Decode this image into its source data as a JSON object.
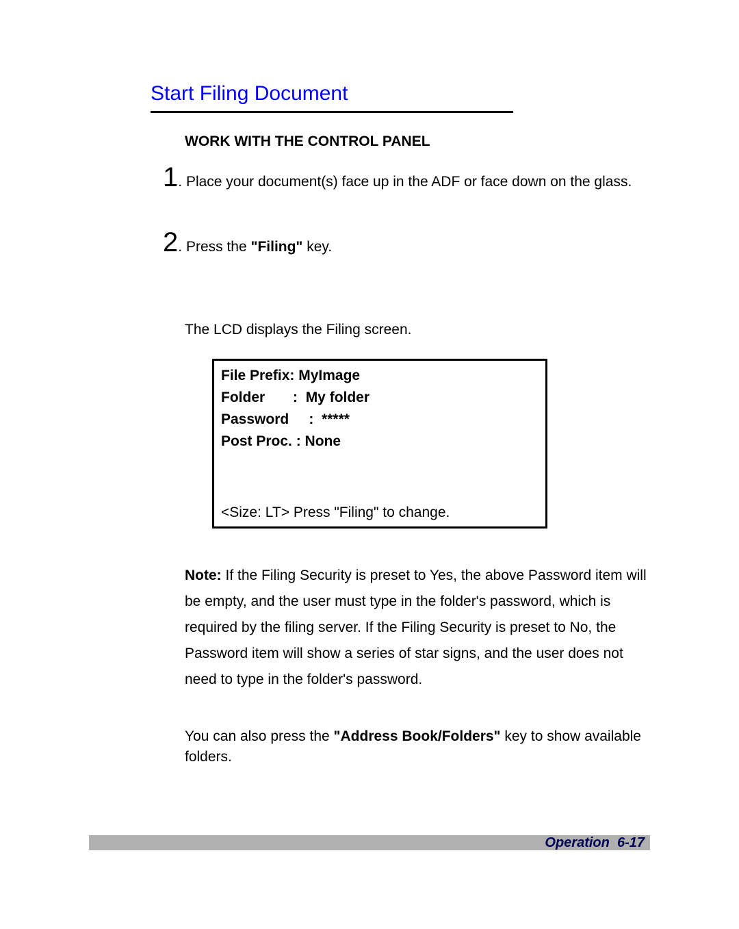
{
  "title": "Start Filing Document",
  "subheading": "WORK WITH THE CONTROL PANEL",
  "step1": {
    "num": "1",
    "text": "Place your document(s) face up in the ADF or face down on the glass."
  },
  "step2": {
    "num": "2",
    "textPrefix": "Press the ",
    "keyName": "\"Filing\"",
    "textSuffix": " key."
  },
  "lcdIntro": "The LCD displays the Filing screen.",
  "lcd": {
    "filePrefix": {
      "label": "File Prefix:",
      "value": "MyImage"
    },
    "folder": {
      "label": "Folder",
      "sep": ":",
      "value": "My  folder"
    },
    "password": {
      "label": "Password",
      "sep": ":",
      "value": "*****"
    },
    "postProc": {
      "label": "Post Proc. :",
      "value": "None"
    },
    "status": "<Size: LT> Press \"Filing\" to change."
  },
  "note": {
    "prefix": "Note:",
    "body": "If the Filing Security is preset to Yes, the above Password item will be empty, and the user must type in the folder's password, which is required by the filing server. If the Filing Security is preset to No, the Password item will show a series of star signs, and the user does not need to type in the folder's password."
  },
  "addrPara": {
    "prefix": "You can also press the ",
    "keyName": "\"Address Book/Folders\"",
    "suffix": " key to show available folders."
  },
  "footer": {
    "section": "Operation",
    "page": "6-17"
  }
}
